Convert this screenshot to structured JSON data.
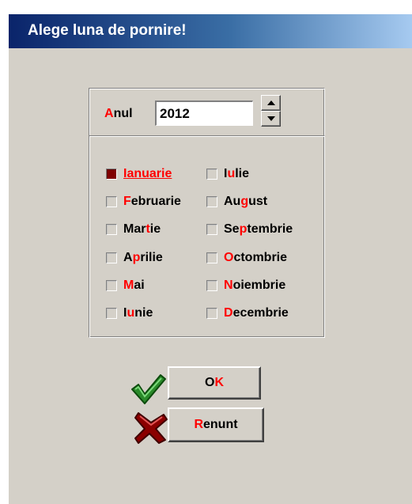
{
  "window": {
    "title": "Alege luna de pornire!",
    "title_color": "#0a246a"
  },
  "year": {
    "label_hotkey": "A",
    "label_rest": "nul",
    "value": "2012"
  },
  "months": [
    {
      "pre": "",
      "hk": "I",
      "post": "anuarie",
      "checked": true
    },
    {
      "pre": "",
      "hk": "F",
      "post": "ebruarie",
      "checked": false
    },
    {
      "pre": "Mar",
      "hk": "t",
      "post": "ie",
      "checked": false
    },
    {
      "pre": "A",
      "hk": "p",
      "post": "rilie",
      "checked": false
    },
    {
      "pre": "",
      "hk": "M",
      "post": "ai",
      "checked": false
    },
    {
      "pre": "I",
      "hk": "u",
      "post": "nie",
      "checked": false
    },
    {
      "pre": "I",
      "hk": "u",
      "post": "lie",
      "checked": false
    },
    {
      "pre": "Au",
      "hk": "g",
      "post": "ust",
      "checked": false
    },
    {
      "pre": "Se",
      "hk": "p",
      "post": "tembrie",
      "checked": false
    },
    {
      "pre": "",
      "hk": "O",
      "post": "ctombrie",
      "checked": false
    },
    {
      "pre": "",
      "hk": "N",
      "post": "oiembrie",
      "checked": false
    },
    {
      "pre": "",
      "hk": "D",
      "post": "ecembrie",
      "checked": false
    }
  ],
  "buttons": {
    "ok": {
      "pre": "O",
      "hk": "K"
    },
    "cancel": {
      "hk": "R",
      "post": "enunt"
    }
  },
  "colors": {
    "hotkey": "#ff0000",
    "checked": "#800000",
    "dialog_bg": "#d4d0c8",
    "ok_icon": "#2a8a2a",
    "cancel_icon": "#8b0000"
  },
  "icons": {
    "ok": "checkmark-icon",
    "cancel": "x-icon"
  }
}
